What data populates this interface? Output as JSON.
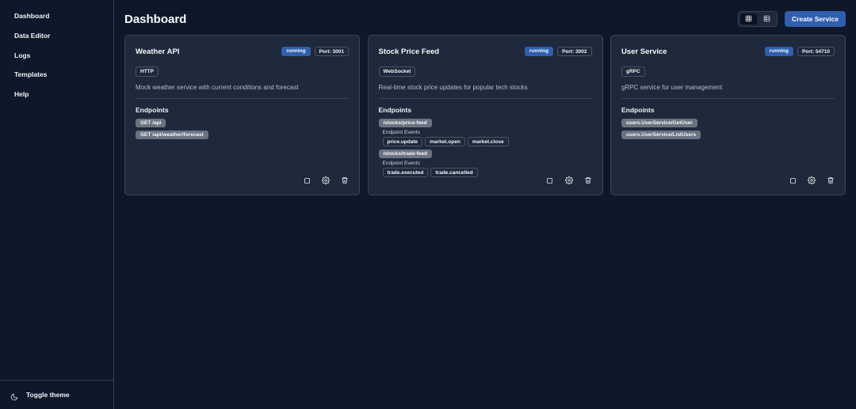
{
  "sidebar": {
    "items": [
      {
        "label": "Dashboard"
      },
      {
        "label": "Data Editor"
      },
      {
        "label": "Logs"
      },
      {
        "label": "Templates"
      },
      {
        "label": "Help"
      }
    ],
    "footer": {
      "label": "Toggle theme",
      "icon": "moon-icon"
    }
  },
  "header": {
    "title": "Dashboard",
    "create_label": "Create Service",
    "view_toggle": {
      "active": "grid-view",
      "icons": [
        "grid-view-icon",
        "table-view-icon"
      ]
    }
  },
  "colors": {
    "background": "#0f172a",
    "card": "#1e293b",
    "accent": "#2f5fae",
    "chip": "#6b7280"
  },
  "services": [
    {
      "name": "Weather API",
      "status": "running",
      "port": "Port: 3001",
      "protocol": "HTTP",
      "description": "Mock weather service with current conditions and forecast",
      "endpoints_title": "Endpoints",
      "endpoints": [
        {
          "path": "GET /api"
        },
        {
          "path": "GET /api/weather/forecast"
        }
      ]
    },
    {
      "name": "Stock Price Feed",
      "status": "running",
      "port": "Port: 3002",
      "protocol": "WebSocket",
      "description": "Real-time stock price updates for popular tech stocks",
      "endpoints_title": "Endpoints",
      "endpoints": [
        {
          "path": "/stocks/price-feed",
          "events_label": "Endpoint Events",
          "events": [
            "price.update",
            "market.open",
            "market.close"
          ]
        },
        {
          "path": "/stocks/trade-feed",
          "events_label": "Endpoint Events",
          "events": [
            "trade.executed",
            "trade.cancelled"
          ]
        }
      ]
    },
    {
      "name": "User Service",
      "status": "running",
      "port": "Port: 54710",
      "protocol": "gRPC",
      "description": "gRPC service for user management",
      "endpoints_title": "Endpoints",
      "endpoints": [
        {
          "path": "users.UserService/GetUser"
        },
        {
          "path": "users.UserService/ListUsers"
        }
      ]
    }
  ],
  "card_action_icons": [
    "square-icon",
    "gear-icon",
    "trash-icon"
  ]
}
